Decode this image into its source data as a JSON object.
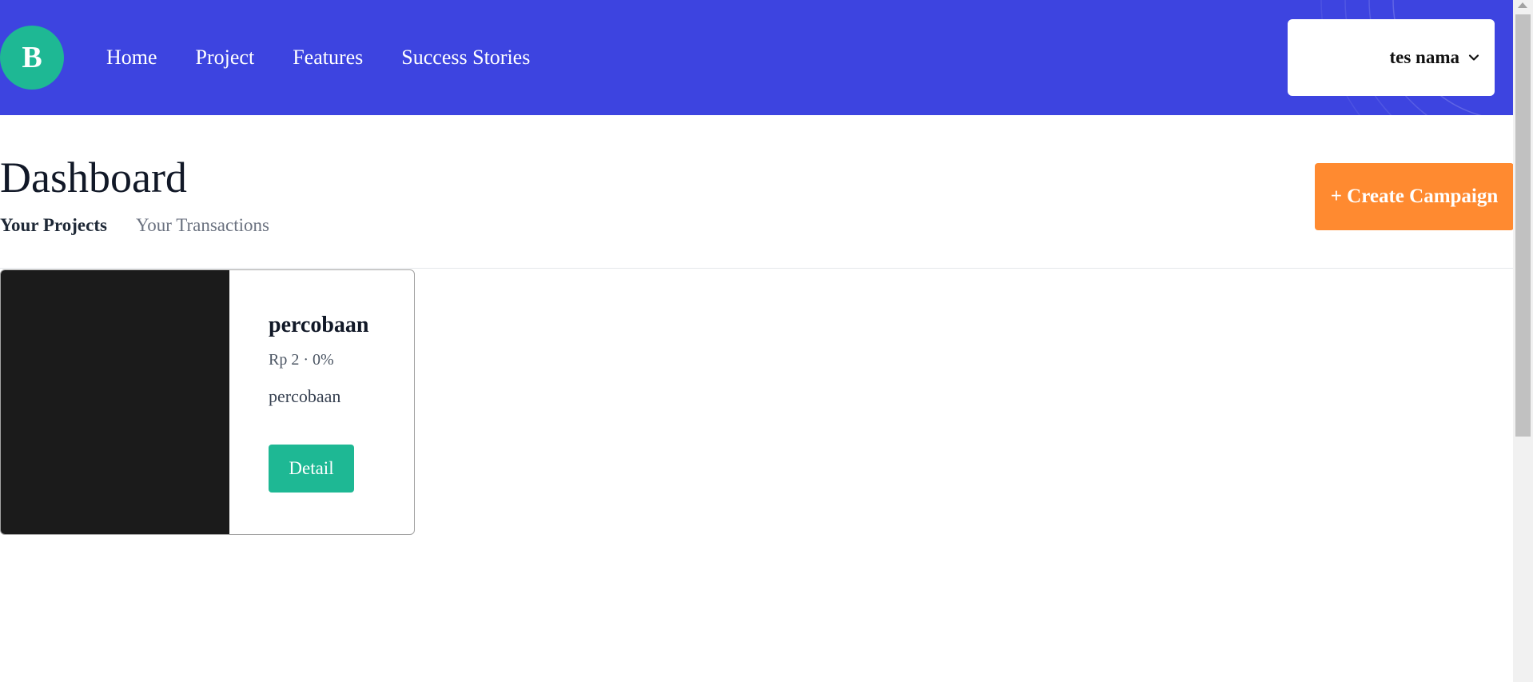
{
  "header": {
    "logo_letter": "B",
    "nav": [
      "Home",
      "Project",
      "Features",
      "Success Stories"
    ],
    "user_name": "tes nama",
    "colors": {
      "background": "#3d44e0",
      "logo": "#1eb894"
    }
  },
  "page": {
    "title": "Dashboard",
    "tabs": [
      {
        "label": "Your Projects",
        "active": true
      },
      {
        "label": "Your Transactions",
        "active": false
      }
    ],
    "create_button": "+ Create Campaign",
    "create_button_color": "#ff8a30"
  },
  "projects": [
    {
      "title": "percobaan",
      "meta": "Rp 2 · 0%",
      "description": "percobaan",
      "action": "Detail"
    }
  ]
}
